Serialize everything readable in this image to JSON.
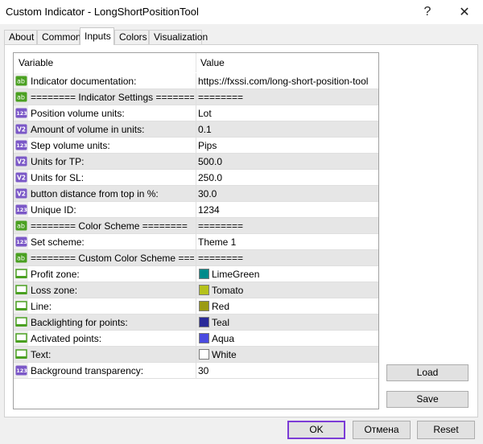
{
  "window": {
    "title": "Custom Indicator - LongShortPositionTool",
    "help_glyph": "?",
    "close_glyph": "✕"
  },
  "tabs": [
    {
      "label": "About"
    },
    {
      "label": "Common"
    },
    {
      "label": "Inputs"
    },
    {
      "label": "Colors"
    },
    {
      "label": "Visualization"
    }
  ],
  "active_tab": "Inputs",
  "grid": {
    "col_variable": "Variable",
    "col_value": "Value",
    "rows": [
      {
        "name": "Indicator documentation:",
        "value": "https://fxssi.com/long-short-position-tool",
        "icon": "ab-icon"
      },
      {
        "name": "======== Indicator Settings ========",
        "value": "========",
        "icon": "ab-icon"
      },
      {
        "name": "Position volume units:",
        "value": "Lot",
        "icon": "123-icon"
      },
      {
        "name": "Amount of volume in units:",
        "value": "0.1",
        "icon": "v2-icon"
      },
      {
        "name": "Step volume units:",
        "value": "Pips",
        "icon": "123-icon"
      },
      {
        "name": "Units for TP:",
        "value": "500.0",
        "icon": "v2-icon"
      },
      {
        "name": "Units for SL:",
        "value": "250.0",
        "icon": "v2-icon"
      },
      {
        "name": "button distance from top in %:",
        "value": "30.0",
        "icon": "v2-icon"
      },
      {
        "name": "Unique ID:",
        "value": "1234",
        "icon": "123-icon"
      },
      {
        "name": "======== Color Scheme ========",
        "value": "========",
        "icon": "ab-icon"
      },
      {
        "name": "Set scheme:",
        "value": "Theme 1",
        "icon": "123-icon"
      },
      {
        "name": "======== Custom Color Scheme ========",
        "value": "========",
        "icon": "ab-icon"
      },
      {
        "name": "Profit zone:",
        "value": "LimeGreen",
        "icon": "color-icon",
        "color": "#008b8b"
      },
      {
        "name": "Loss zone:",
        "value": "Tomato",
        "icon": "color-icon",
        "color": "#b5c21c"
      },
      {
        "name": "Line:",
        "value": "Red",
        "icon": "color-icon",
        "color": "#9b9b13"
      },
      {
        "name": "Backlighting for points:",
        "value": "Teal",
        "icon": "color-icon",
        "color": "#2a2a99"
      },
      {
        "name": "Activated points:",
        "value": "Aqua",
        "icon": "color-icon",
        "color": "#4b4be0"
      },
      {
        "name": "Text:",
        "value": "White",
        "icon": "color-icon",
        "color": "#ffffff"
      },
      {
        "name": "Background transparency:",
        "value": "30",
        "icon": "123-icon"
      }
    ]
  },
  "side_buttons": {
    "load": "Load",
    "save": "Save"
  },
  "footer": {
    "ok": "OK",
    "cancel": "Отмена",
    "reset": "Reset"
  },
  "colors": {
    "accent": "#7b3bd6",
    "icon_green": "#4aa021",
    "icon_purple": "#7b58c7"
  }
}
